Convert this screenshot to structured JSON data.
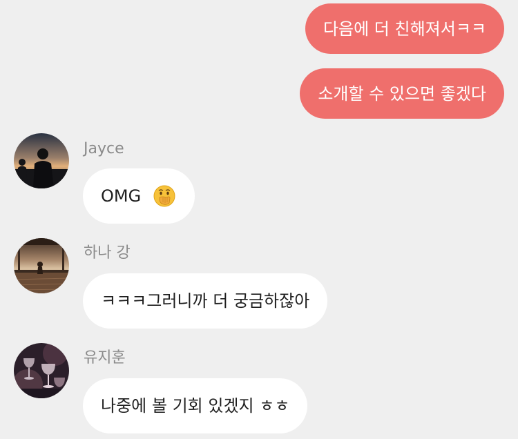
{
  "messages": {
    "outgoing": [
      {
        "text": "다음에 더 친해져서ㅋㅋ"
      },
      {
        "text": "소개할 수 있으면 좋겠다"
      }
    ],
    "incoming": [
      {
        "sender": "Jayce",
        "text": "OMG",
        "emoji": "face-with-hand-over-mouth-emoji"
      },
      {
        "sender": "하나 강",
        "text": "ㅋㅋㅋ그러니까 더 궁금하잖아"
      },
      {
        "sender": "유지훈",
        "text": "나중에 볼 기회 있겠지 ㅎㅎ"
      }
    ]
  },
  "colors": {
    "background": "#efefef",
    "outgoing_bubble": "#ef6f6c",
    "incoming_bubble": "#ffffff",
    "sender_name": "#8a8a8a"
  }
}
